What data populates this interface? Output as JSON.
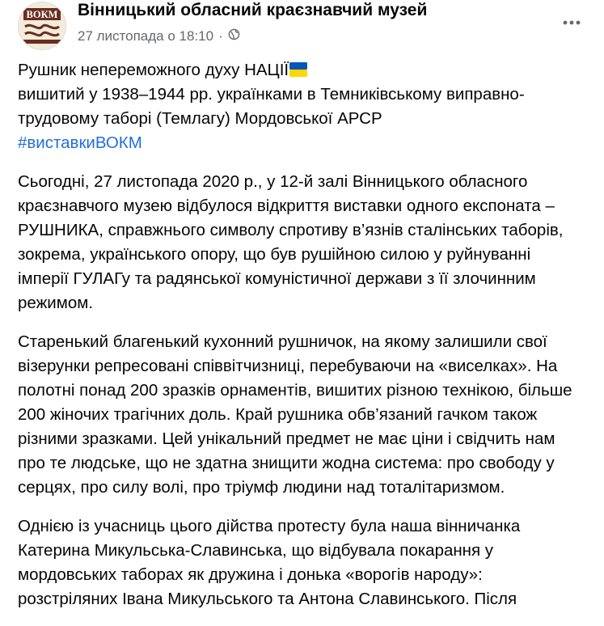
{
  "header": {
    "page_name": "Вінницький обласний краєзнавчий музей",
    "timestamp": "27 листопада о 18:10",
    "separator": "·",
    "avatar_text": "ВОКМ",
    "privacy_icon": "globe-icon",
    "more_icon": "ellipsis-icon"
  },
  "post": {
    "title_line1": "Рушник непереможного духу НАЦІЇ",
    "title_line2": "вишитий у 1938–1944 рр. українками в Темниківському виправно-трудовому таборі (Темлагу) Мордовської АРСР",
    "hashtag": "#виставкиВОКМ",
    "paragraph1": "Сьогодні, 27 листопада 2020 р., у 12-й залі Вінницького обласного краєзнавчого музею відбулося відкриття виставки одного експоната – РУШНИКА, справжнього символу  спротиву в’язнів сталінських таборів, зокрема, українського опору, що був рушійною силою у руйнуванні імперії ГУЛАГу та радянської комуністичної держави з її злочинним режимом.",
    "paragraph2": "Старенький благенький кухонний рушничок, на якому залишили свої візерунки репресовані співвітчизниці, перебуваючи на «виселках». На полотні понад 200 зразків орнаментів, вишитих різною технікою, більше 200 жіночих трагічних доль. Край рушника обв’язаний гачком також різними зразками. Цей унікальний предмет не має ціни і свідчить нам про те людське, що не здатна знищити жодна система: про свободу у серцях, про силу волі, про тріумф людини над тоталітаризмом.",
    "paragraph3": "Однією із учасниць цього дійства протесту була наша вінничанка Катерина Микульська-Славинська, що відбувала покарання у мордовських таборах як дружина і донька «ворогів народу»: розстріляних Івана Микульського та Антона Славинського. Після"
  },
  "colors": {
    "text": "#050505",
    "secondary": "#65676b",
    "link": "#216fdb",
    "flag_blue": "#0057b7",
    "flag_yellow": "#ffd700"
  }
}
